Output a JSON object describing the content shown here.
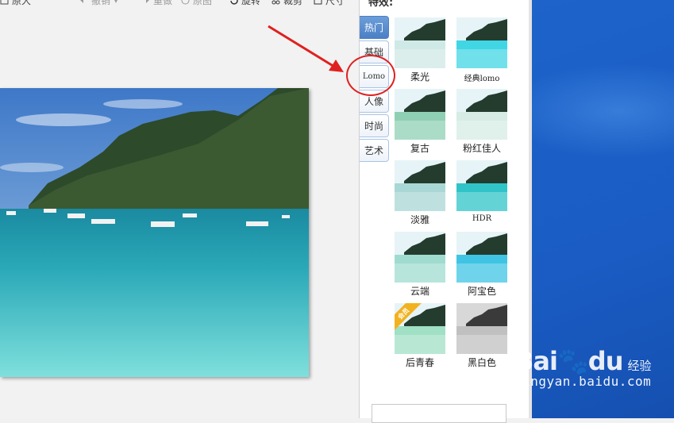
{
  "toolbar": {
    "items": [
      {
        "label": "原大",
        "icon": "actual-size-icon"
      },
      {
        "label": "撤销",
        "icon": "undo-icon"
      },
      {
        "label": "重做",
        "icon": "redo-icon"
      },
      {
        "label": "原图",
        "icon": "original-icon"
      },
      {
        "label": "旋转",
        "icon": "rotate-icon"
      },
      {
        "label": "裁剪",
        "icon": "crop-icon"
      },
      {
        "label": "尺寸",
        "icon": "resize-icon"
      }
    ]
  },
  "panel": {
    "title": "特效:",
    "tabs": [
      {
        "label": "热门",
        "active": true
      },
      {
        "label": "基础",
        "active": false
      },
      {
        "label": "Lomo",
        "active": false
      },
      {
        "label": "人像",
        "active": false
      },
      {
        "label": "时尚",
        "active": false
      },
      {
        "label": "艺术",
        "active": false
      }
    ],
    "effects": [
      {
        "label": "柔光",
        "tint": "#cfe9e6"
      },
      {
        "label": "经典lomo",
        "tint": "#40d6e4"
      },
      {
        "label": "复古",
        "tint": "#8fd0b4"
      },
      {
        "label": "粉红佳人",
        "tint": "#d6ece4"
      },
      {
        "label": "淡雅",
        "tint": "#a8d7d6"
      },
      {
        "label": "HDR",
        "tint": "#30c4c8"
      },
      {
        "label": "云端",
        "tint": "#9fdccf"
      },
      {
        "label": "阿宝色",
        "tint": "#3fc4e4"
      },
      {
        "label": "后青春",
        "tint": "#a0e0c4",
        "badge": "会员"
      },
      {
        "label": "黑白色",
        "tint": "#c0c0c0"
      }
    ]
  },
  "watermark": {
    "logo": "Bai",
    "logo_paw": "du",
    "sub": "经验",
    "url": "jingyan.baidu.com"
  }
}
